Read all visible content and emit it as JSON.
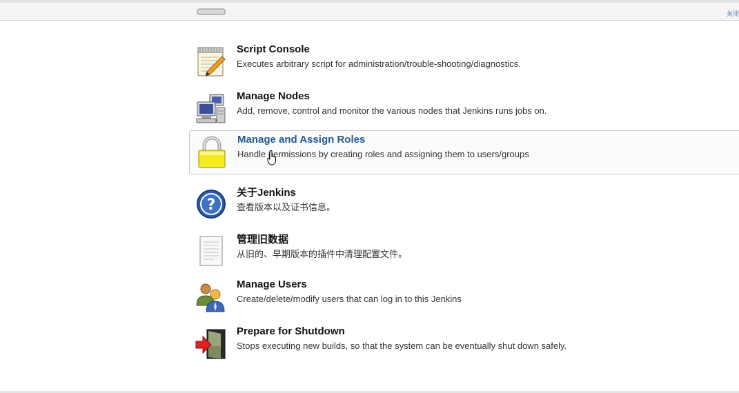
{
  "topbar": {
    "link_label": "关闭"
  },
  "items": [
    {
      "title": "",
      "description": "",
      "icon": "partial-icon"
    },
    {
      "title": "Script Console",
      "description": "Executes arbitrary script for administration/trouble-shooting/diagnostics.",
      "icon": "notepad-pencil-icon"
    },
    {
      "title": "Manage Nodes",
      "description": "Add, remove, control and monitor the various nodes that Jenkins runs jobs on.",
      "icon": "network-computers-icon"
    },
    {
      "title": "Manage and Assign Roles",
      "description": "Handle permissions by creating roles and assigning them to users/groups",
      "icon": "padlock-icon"
    },
    {
      "title": "关于Jenkins",
      "description": "查看版本以及证书信息。",
      "icon": "help-question-icon"
    },
    {
      "title": "管理旧数据",
      "description": "从旧的、早期版本的插件中清理配置文件。",
      "icon": "document-icon"
    },
    {
      "title": "Manage Users",
      "description": "Create/delete/modify users that can log in to this Jenkins",
      "icon": "users-icon"
    },
    {
      "title": "Prepare for Shutdown",
      "description": "Stops executing new builds, so that the system can be eventually shut down safely.",
      "icon": "exit-door-icon"
    }
  ],
  "colors": {
    "link": "#245a8d",
    "title": "#111111",
    "text": "#333333"
  }
}
